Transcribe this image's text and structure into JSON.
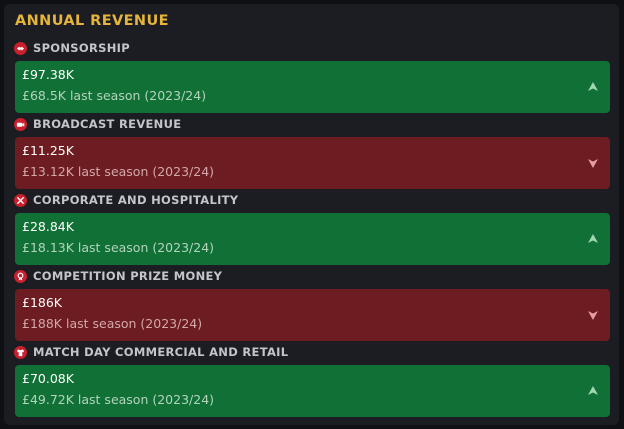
{
  "panel": {
    "title": "ANNUAL REVENUE"
  },
  "colors": {
    "title": "#e5b43a",
    "positive": "#107035",
    "negative": "#6d1d21",
    "positive_arrow": "#9fd8b2",
    "negative_arrow": "#e29ea3",
    "icon_bg": "#c8202c"
  },
  "revenue_items": [
    {
      "label": "SPONSORSHIP",
      "icon": "handshake-icon",
      "value": "£97.38K",
      "last_season": "£68.5K last season (2023/24)",
      "trend": "up"
    },
    {
      "label": "BROADCAST REVENUE",
      "icon": "camera-icon",
      "value": "£11.25K",
      "last_season": "£13.12K last season (2023/24)",
      "trend": "down"
    },
    {
      "label": "CORPORATE AND HOSPITALITY",
      "icon": "cutlery-icon",
      "value": "£28.84K",
      "last_season": "£18.13K last season (2023/24)",
      "trend": "up"
    },
    {
      "label": "COMPETITION PRIZE MONEY",
      "icon": "medal-icon",
      "value": "£186K",
      "last_season": "£188K last season (2023/24)",
      "trend": "down"
    },
    {
      "label": "MATCH DAY COMMERCIAL AND RETAIL",
      "icon": "shirt-icon",
      "value": "£70.08K",
      "last_season": "£49.72K last season (2023/24)",
      "trend": "up"
    }
  ]
}
